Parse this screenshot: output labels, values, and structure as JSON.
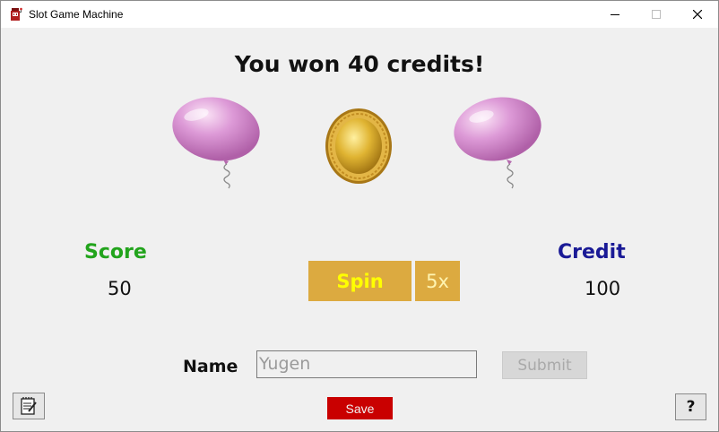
{
  "window": {
    "title": "Slot Game Machine",
    "controls": [
      "minimize-icon",
      "maximize-icon",
      "close-icon"
    ]
  },
  "game": {
    "message": "You won 40 credits!",
    "reels": [
      {
        "symbol": "pink-balloon-icon"
      },
      {
        "symbol": "gold-coin-icon"
      },
      {
        "symbol": "pink-balloon-icon"
      }
    ]
  },
  "score": {
    "label": "Score",
    "value": "50"
  },
  "credit": {
    "label": "Credit",
    "value": "100"
  },
  "controls": {
    "spin_label": "Spin",
    "multiplier_label": "5x"
  },
  "player": {
    "name_label": "Name",
    "name_placeholder": "Yugen",
    "name_value": "",
    "submit_label": "Submit"
  },
  "footer": {
    "notes_icon": "notepad-icon",
    "save_label": "Save",
    "help_label": "?"
  },
  "colors": {
    "score_label": "#22a41c",
    "credit_label": "#1a1a96",
    "spin_button": "#dcaa40",
    "spin_text": "#ffff00",
    "save_button": "#c90000"
  }
}
